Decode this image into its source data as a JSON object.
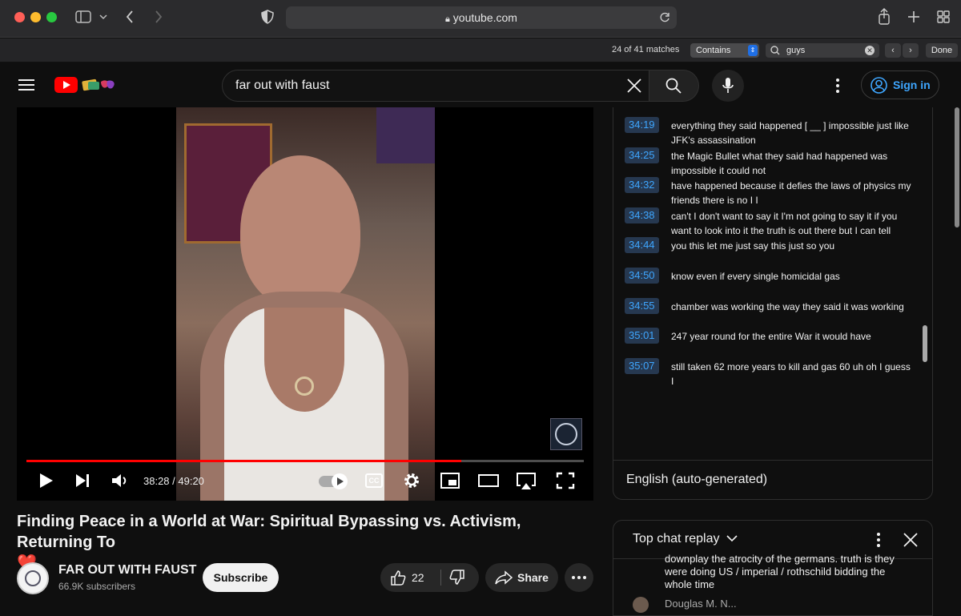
{
  "browser": {
    "url": "youtube.com",
    "find": {
      "count": "24 of 41 matches",
      "mode": "Contains",
      "query": "guys",
      "done_label": "Done"
    }
  },
  "header": {
    "search_value": "far out with faust",
    "sign_in_label": "Sign in"
  },
  "player": {
    "time": "38:28 / 49:20",
    "progress": 0.78
  },
  "transcript": {
    "segments": [
      {
        "time": "34:19",
        "text": "everything they said happened [ __ ] impossible just like JFK's assassination"
      },
      {
        "time": "34:25",
        "text": "the Magic Bullet what they said had happened was impossible it could not"
      },
      {
        "time": "34:32",
        "text": "have happened because it defies the laws of physics my friends there is no I I"
      },
      {
        "time": "34:38",
        "text": "can't I don't want to say it I'm not going to say it if you want to look into it the truth is out there but I can tell"
      },
      {
        "time": "34:44",
        "text": "you this let me just say this just so you"
      },
      {
        "time": "34:50",
        "text": "know even if every single homicidal gas"
      },
      {
        "time": "34:55",
        "text": "chamber was working the way they said it was working"
      },
      {
        "time": "35:01",
        "text": "247 year round for the entire War it would have"
      },
      {
        "time": "35:07",
        "text": "still taken 62 more years to kill and gas 60 uh oh I guess I"
      }
    ],
    "language": "English (auto-generated)"
  },
  "chat": {
    "title": "Top chat replay",
    "message_partial": "downplay the atrocity of the germans. truth is they were doing US / imperial / rothschild bidding the whole time",
    "author_partial": "Douglas M. N..."
  },
  "video": {
    "title": "Finding Peace in a World at War: Spiritual Bypassing vs. Activism, Returning To",
    "title_emoji": "❤️",
    "channel": "FAR OUT WITH FAUST",
    "subscribers": "66.9K subscribers",
    "subscribe_label": "Subscribe",
    "likes": "22",
    "share_label": "Share"
  },
  "colors": {
    "accent_red": "#ff0000",
    "link_blue": "#3ea6ff"
  }
}
